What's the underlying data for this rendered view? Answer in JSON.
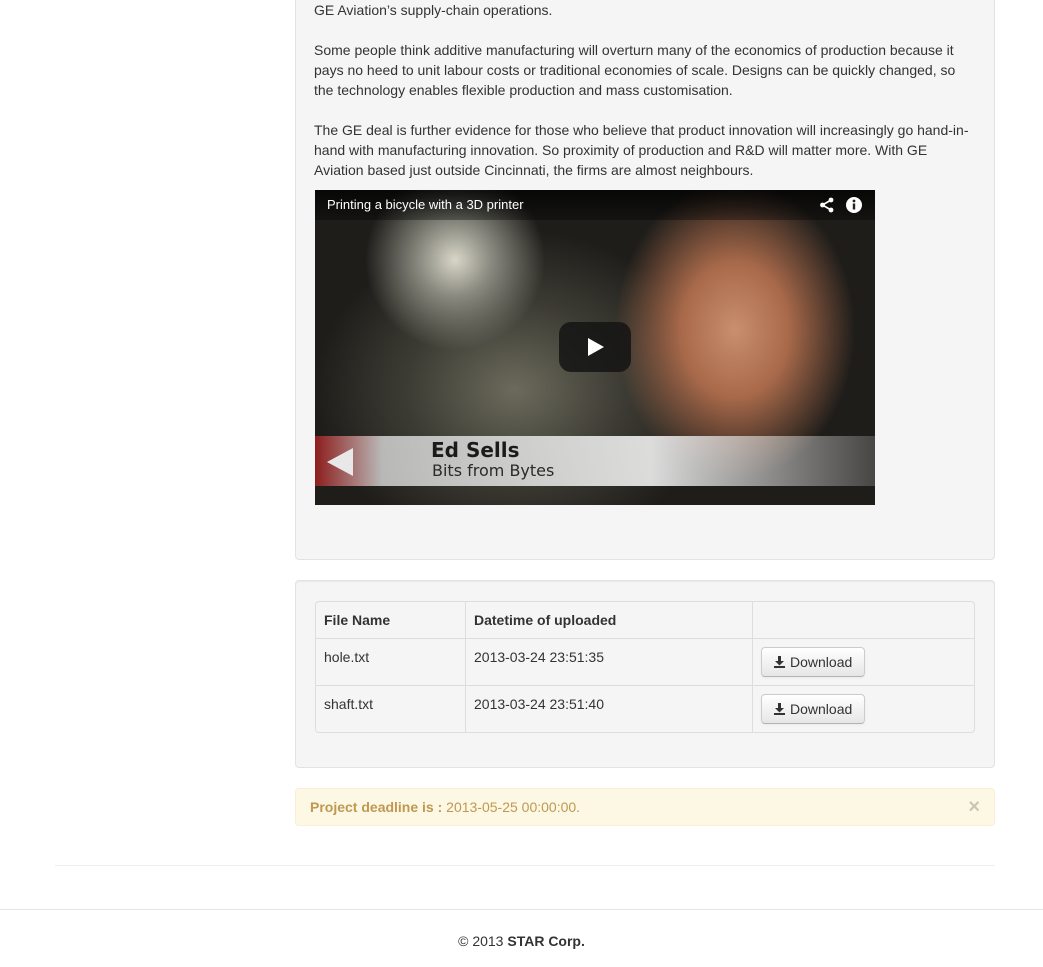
{
  "article": {
    "paragraph_1_tail": "GE Aviation’s supply-chain operations.",
    "paragraph_2": "Some people think additive manufacturing will overturn many of the economics of production because it pays no heed to unit labour costs or traditional economies of scale. Designs can be quickly changed, so the technology enables flexible production and mass customisation.",
    "paragraph_3": "The GE deal is further evidence for those who believe that product innovation will increasingly go hand-in-hand with manufacturing innovation. So proximity of production and R&D will matter more. With GE Aviation based just outside Cincinnati, the firms are almost neighbours."
  },
  "video": {
    "title": "Printing a bicycle with a 3D printer",
    "lower_third_name": "Ed Sells",
    "lower_third_subtitle": "Bits from Bytes",
    "icons": [
      "share-icon",
      "info-icon",
      "play-icon"
    ]
  },
  "files": {
    "headers": [
      "File Name",
      "Datetime of uploaded",
      ""
    ],
    "rows": [
      {
        "name": "hole.txt",
        "datetime": "2013-03-24 23:51:35",
        "action": "Download"
      },
      {
        "name": "shaft.txt",
        "datetime": "2013-03-24 23:51:40",
        "action": "Download"
      }
    ],
    "action_icon": "download-icon"
  },
  "alert": {
    "label": "Project deadline is :",
    "value": " 2013-05-25 00:00:00.",
    "close": "×",
    "colors": {
      "background": "#fcf8e3",
      "text": "#c09853"
    }
  },
  "footer": {
    "prefix": "© 2013 ",
    "brand": "STAR Corp."
  }
}
